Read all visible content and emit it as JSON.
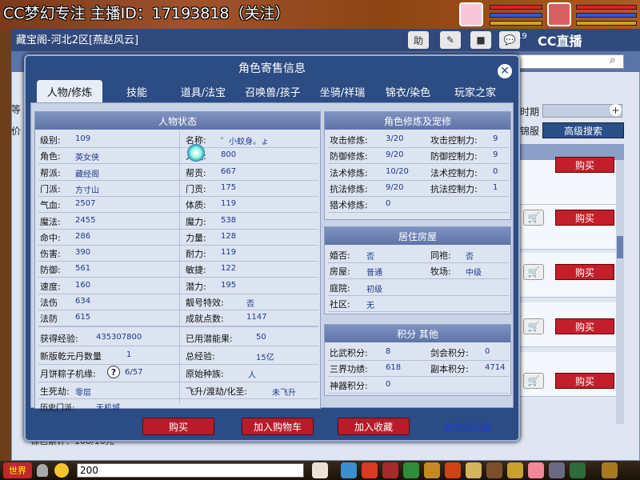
{
  "stream": {
    "title": "CC梦幻专注  主播ID：17193818（关注）",
    "cc_logo": "CC直播",
    "notify_count": "19"
  },
  "site": {
    "title": "藏宝阁-河北2区[燕赵风云]",
    "header_buttons": [
      "助",
      "✎",
      "■",
      "💬"
    ],
    "side_period": "时期",
    "side_clothes": "锦服",
    "adv_search": "高级搜索",
    "left_stub_1": "等",
    "left_stub_2": "价",
    "bottom_stub": "锦色累计：100/10元",
    "buy_labels": [
      "购买",
      "购买",
      "购买",
      "购买",
      "购买"
    ]
  },
  "modal": {
    "title": "角色寄售信息",
    "close": "✕",
    "tabs": [
      "人物/修炼",
      "技能",
      "道具/法宝",
      "召唤兽/孩子",
      "坐骑/祥瑞",
      "锦衣/染色",
      "玩家之家"
    ],
    "active_tab": 0,
    "status": {
      "header": "人物状态",
      "left": [
        {
          "label": "级别:",
          "value": "109"
        },
        {
          "label": "角色:",
          "value": "英女侠"
        },
        {
          "label": "帮派:",
          "value": "藏经阁"
        },
        {
          "label": "门派:",
          "value": "方寸山"
        },
        {
          "label": "气血:",
          "value": "2507"
        },
        {
          "label": "魔法:",
          "value": "2455"
        },
        {
          "label": "命中:",
          "value": "286"
        },
        {
          "label": "伤害:",
          "value": "390"
        },
        {
          "label": "防御:",
          "value": "561"
        },
        {
          "label": "速度:",
          "value": "160"
        },
        {
          "label": "法伤",
          "value": "634"
        },
        {
          "label": "法防",
          "value": "615"
        }
      ],
      "right": [
        {
          "label": "名称:",
          "value": "゜小蚊身。ょ"
        },
        {
          "label": "人气:",
          "value": "800"
        },
        {
          "label": "帮贡:",
          "value": "667"
        },
        {
          "label": "门贡:",
          "value": "175"
        },
        {
          "label": "体质:",
          "value": "119"
        },
        {
          "label": "魔力:",
          "value": "538"
        },
        {
          "label": "力量:",
          "value": "128"
        },
        {
          "label": "耐力:",
          "value": "119"
        },
        {
          "label": "敏捷:",
          "value": "122"
        },
        {
          "label": "潜力:",
          "value": "195"
        },
        {
          "label": "靓号特效:",
          "value": "否"
        },
        {
          "label": "成就点数:",
          "value": "1147"
        }
      ],
      "exp_label": "获得经验:",
      "exp_value": "435307800",
      "used_potential_label": "已用潜能果:",
      "used_potential_value": "50",
      "qianyuan_label": "新版乾元丹数量",
      "qianyuan_value": "1",
      "total_exp_label": "总经验:",
      "total_exp_value": "15亿",
      "mooncake_label": "月饼粽子机缘:",
      "mooncake_help": "?",
      "mooncake_value": "6/57",
      "origin_label": "原始种族:",
      "origin_value": "人",
      "life_death_label": "生死劫:",
      "life_death_value": "零层",
      "ascend_label": "飞升/渡劫/化圣:",
      "ascend_value": "未飞升",
      "history_label": "历史门派:",
      "history_value": "天机城"
    },
    "cultivation": {
      "header": "角色修炼及宠修",
      "rows": [
        [
          {
            "label": "攻击修炼:",
            "value": "3/20"
          },
          {
            "label": "攻击控制力:",
            "value": "9"
          }
        ],
        [
          {
            "label": "防御修炼:",
            "value": "9/20"
          },
          {
            "label": "防御控制力:",
            "value": "9"
          }
        ],
        [
          {
            "label": "法术修炼:",
            "value": "10/20"
          },
          {
            "label": "法术控制力:",
            "value": "0"
          }
        ],
        [
          {
            "label": "抗法修炼:",
            "value": "9/20"
          },
          {
            "label": "抗法控制力:",
            "value": "1"
          }
        ],
        [
          {
            "label": "猎术修炼:",
            "value": "0"
          }
        ]
      ]
    },
    "house": {
      "header": "居住房屋",
      "rows": [
        [
          {
            "label": "婚否:",
            "value": "否"
          },
          {
            "label": "同袍:",
            "value": "否"
          }
        ],
        [
          {
            "label": "房屋:",
            "value": "普通"
          },
          {
            "label": "牧场:",
            "value": "中级"
          }
        ],
        [
          {
            "label": "庭院:",
            "value": "初级"
          }
        ],
        [
          {
            "label": "社区:",
            "value": "无"
          }
        ]
      ]
    },
    "points": {
      "header": "积分 其他",
      "rows": [
        [
          {
            "label": "比武积分:",
            "value": "8"
          },
          {
            "label": "剑会积分:",
            "value": "0"
          }
        ],
        [
          {
            "label": "三界功绩:",
            "value": "618"
          },
          {
            "label": "副本积分:",
            "value": "4714"
          }
        ],
        [
          {
            "label": "神器积分:",
            "value": "0"
          }
        ]
      ]
    },
    "buttons": {
      "buy": "购买",
      "add_cart": "加入购物车",
      "add_fav": "加入收藏",
      "web_version": "使用网页版"
    }
  },
  "bottom": {
    "world": "世界",
    "chat_value": "200"
  },
  "colors": {
    "modal_bg": "#2c4c84",
    "button_red": "#b81c2a",
    "panel_head": "#6a7fb4"
  }
}
